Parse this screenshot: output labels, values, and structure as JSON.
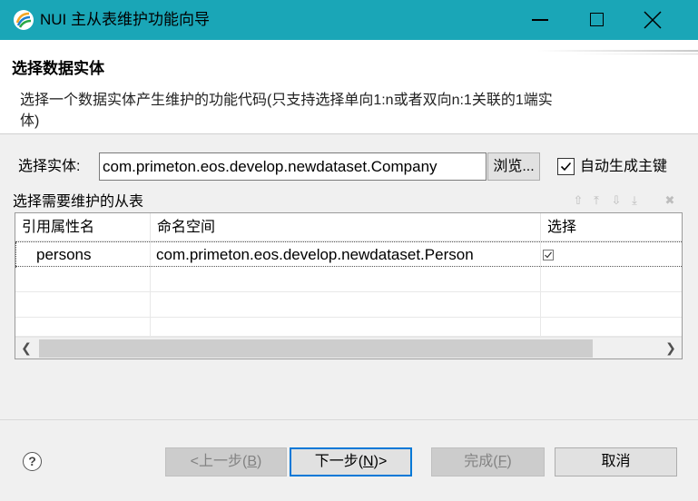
{
  "window": {
    "title": "NUI 主从表维护功能向导"
  },
  "header": {
    "title": "选择数据实体",
    "description": "选择一个数据实体产生维护的功能代码(只支持选择单向1:n或者双向n:1关联的1端实体)"
  },
  "entity": {
    "label": "选择实体:",
    "value": "com.primeton.eos.develop.newdataset.Company",
    "browse_label": "浏览...",
    "auto_pk_label": "自动生成主键",
    "auto_pk_checked": true
  },
  "subtable": {
    "label": "选择需要维护的从表",
    "columns": [
      "引用属性名",
      "命名空间",
      "选择"
    ],
    "rows": [
      {
        "ref": "persons",
        "namespace": "com.primeton.eos.develop.newdataset.Person",
        "selected": true
      }
    ]
  },
  "footer": {
    "back": {
      "pre": "<上一步(",
      "key": "B",
      "post": ")"
    },
    "next": {
      "pre": "下一步(",
      "key": "N",
      "post": ")>"
    },
    "finish": {
      "pre": "完成(",
      "key": "F",
      "post": ")"
    },
    "cancel": "取消"
  },
  "colors": {
    "titlebar": "#1aa6b7",
    "focus": "#0078d7"
  }
}
